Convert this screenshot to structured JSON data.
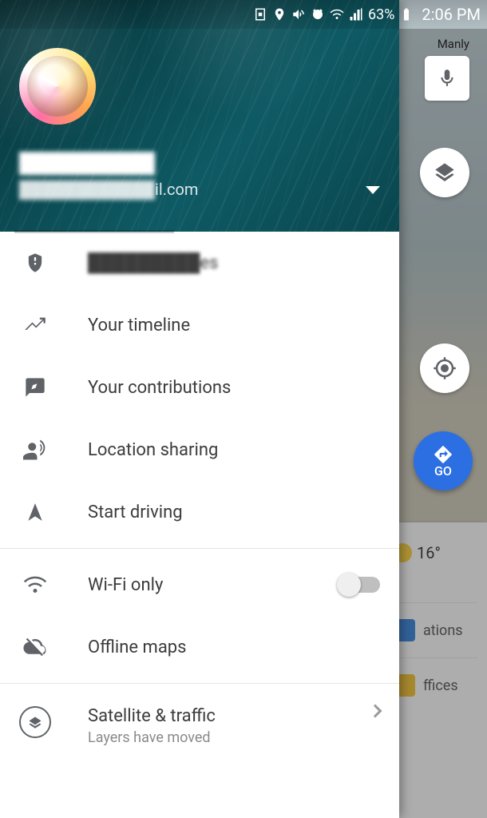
{
  "status_bar": {
    "battery_text": "63%",
    "time": "2:06 PM"
  },
  "map": {
    "label_top": "Manly",
    "go_label": "GO",
    "weather_temp": "16°",
    "card_item_1": "ations",
    "card_item_2": "ffices"
  },
  "drawer": {
    "account": {
      "name": "██████████",
      "email_blurred": "████████████",
      "email_suffix": "il.com"
    },
    "menu": {
      "your_places": "█████████es",
      "timeline": "Your timeline",
      "contributions": "Your contributions",
      "location_sharing": "Location sharing",
      "start_driving": "Start driving",
      "wifi_only": "Wi-Fi only",
      "offline_maps": "Offline maps",
      "satellite_title": "Satellite & traffic",
      "satellite_sub": "Layers have moved"
    }
  }
}
